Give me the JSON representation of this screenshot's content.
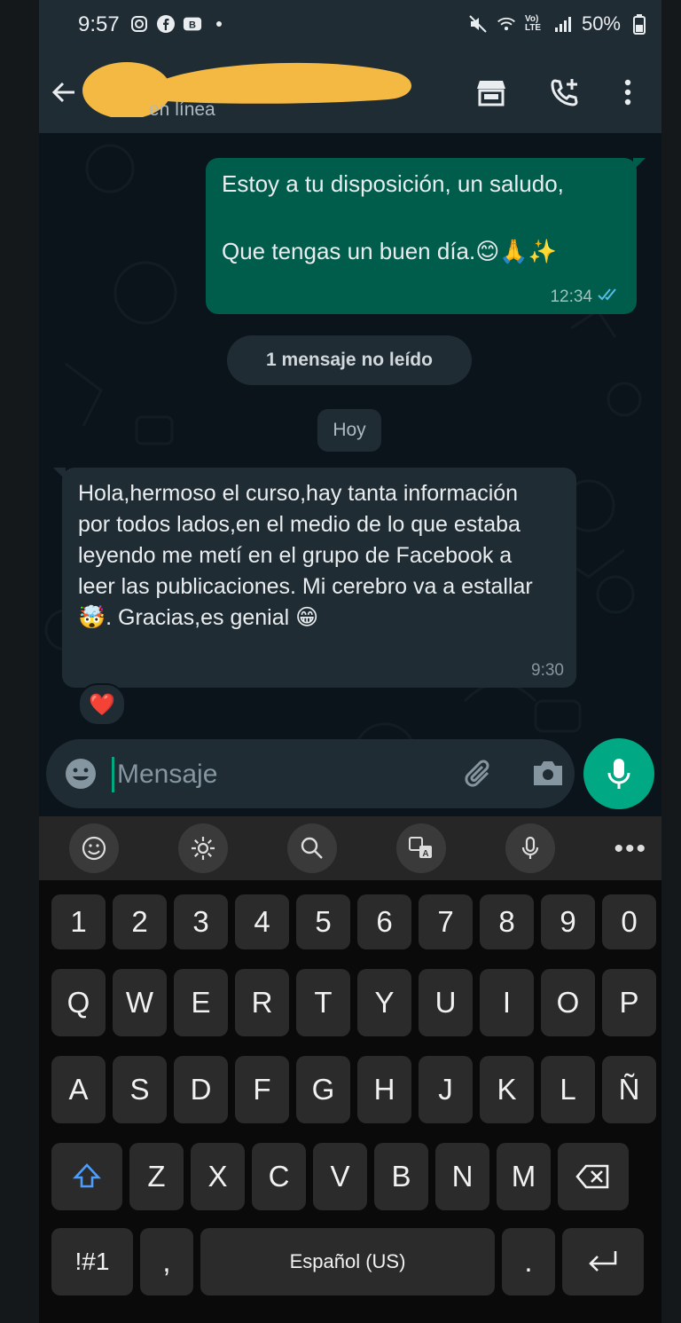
{
  "status_bar": {
    "time": "9:57",
    "battery": "50%",
    "network_label": "Vo) LTE",
    "left_icons": [
      "instagram-icon",
      "facebook-icon",
      "b-app-icon",
      "dot-icon"
    ],
    "right_icons": [
      "mute-icon",
      "wifi-icon",
      "volte-icon",
      "signal-icon",
      "battery-icon"
    ]
  },
  "header": {
    "status": "en línea",
    "contact_name_redacted": true,
    "actions": [
      "store-icon",
      "add-call-icon",
      "more-vert-icon"
    ]
  },
  "messages": {
    "outgoing": {
      "line1": "Estoy a tu disposición, un saludo,",
      "line2": "Que tengas un buen día.😊🙏✨",
      "time": "12:34",
      "status": "read"
    },
    "unread_label": "1 mensaje no leído",
    "date_label": "Hoy",
    "incoming": {
      "text": "Hola,hermoso el curso,hay tanta información por todos lados,en el medio de lo que estaba leyendo me metí en el grupo de Facebook a leer las publicaciones. Mi cerebro va a estallar🤯. Gracias,es genial 😁",
      "time": "9:30",
      "reaction": "❤️"
    }
  },
  "composer": {
    "placeholder": "Mensaje"
  },
  "keyboard": {
    "toolbar": [
      "emoji-icon",
      "settings-icon",
      "search-icon",
      "translate-icon",
      "voice-icon",
      "more-icon"
    ],
    "more_label": "•••",
    "row_numbers": [
      "1",
      "2",
      "3",
      "4",
      "5",
      "6",
      "7",
      "8",
      "9",
      "0"
    ],
    "row1": [
      "Q",
      "W",
      "E",
      "R",
      "T",
      "Y",
      "U",
      "I",
      "O",
      "P"
    ],
    "row2": [
      "A",
      "S",
      "D",
      "F",
      "G",
      "H",
      "J",
      "K",
      "L",
      "Ñ"
    ],
    "row3": [
      "Z",
      "X",
      "C",
      "V",
      "B",
      "N",
      "M"
    ],
    "symbols_label": "!#1",
    "comma_label": ",",
    "space_label": "Español (US)",
    "period_label": "."
  },
  "colors": {
    "accent": "#00a884",
    "outgoing_bubble": "#005c4b",
    "incoming_bubble": "#202c33",
    "header_bg": "#1f2c34",
    "read_ticks": "#53bdeb"
  }
}
